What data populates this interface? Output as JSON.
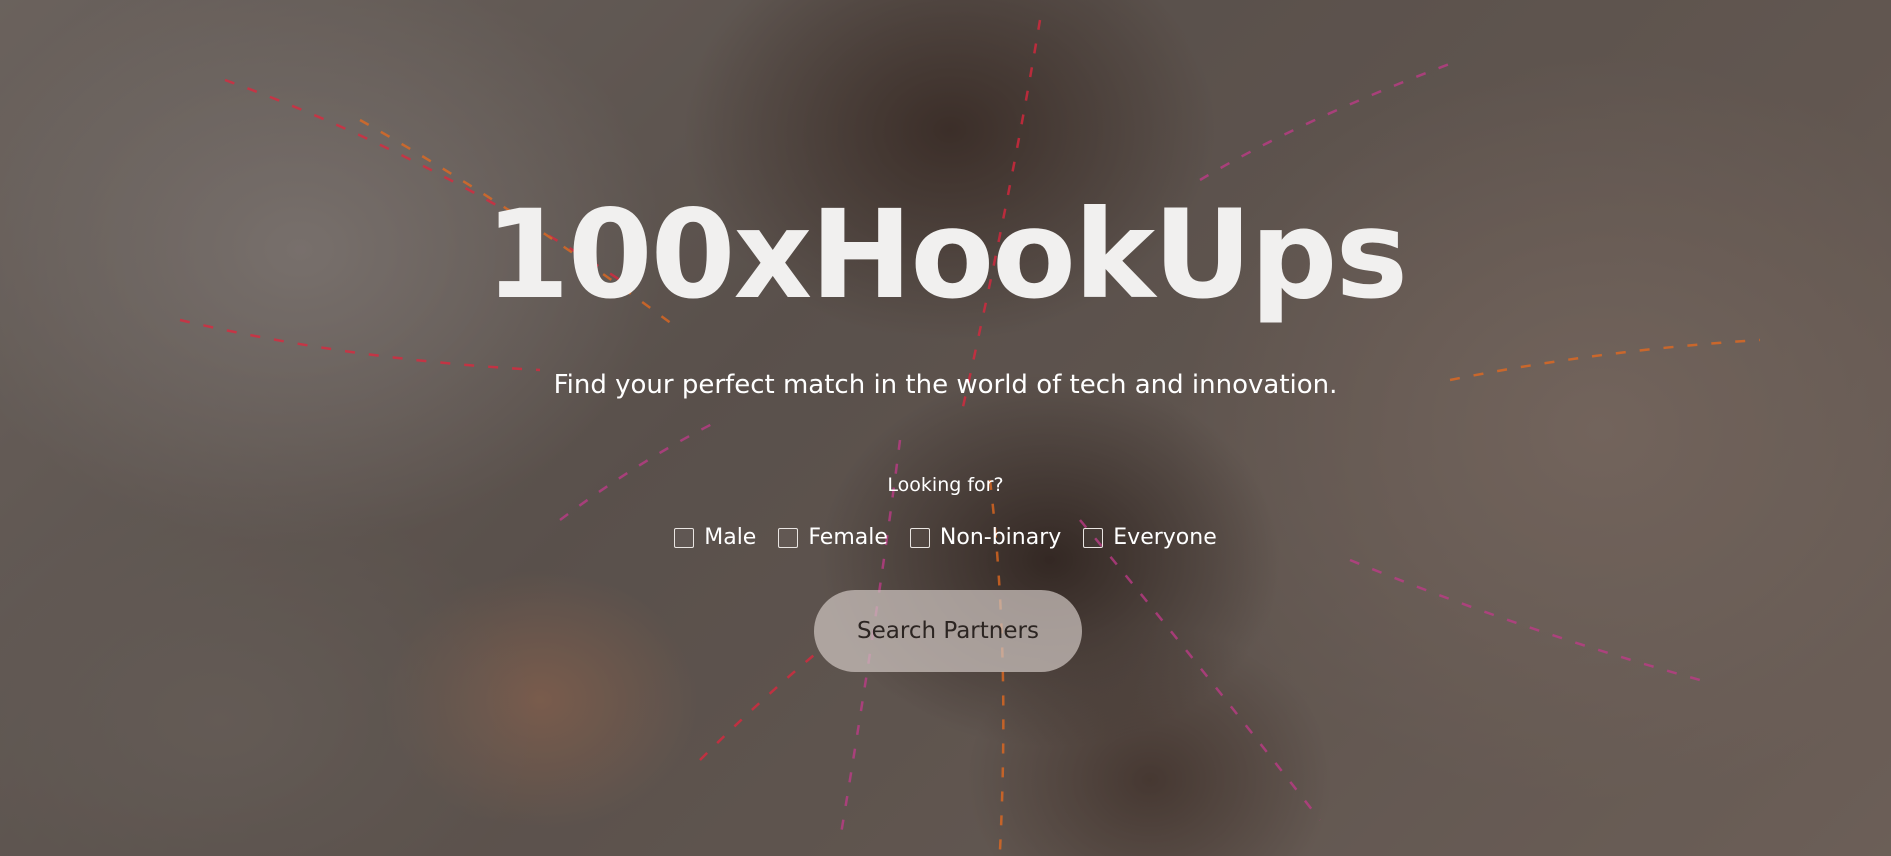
{
  "hero": {
    "title": "100xHookUps",
    "subtitle": "Find your perfect match in the world of tech and innovation.",
    "looking_for_label": "Looking for?",
    "options": [
      {
        "label": "Male",
        "checked": false
      },
      {
        "label": "Female",
        "checked": false
      },
      {
        "label": "Non-binary",
        "checked": false
      },
      {
        "label": "Everyone",
        "checked": false
      }
    ],
    "search_button_label": "Search Partners"
  },
  "colors": {
    "overlay": "#281e1c",
    "text": "#ffffff",
    "button_bg": "#cdc4bf",
    "button_text": "#2c2522",
    "streak_red": "#e0263d",
    "streak_orange": "#e86a1e"
  }
}
